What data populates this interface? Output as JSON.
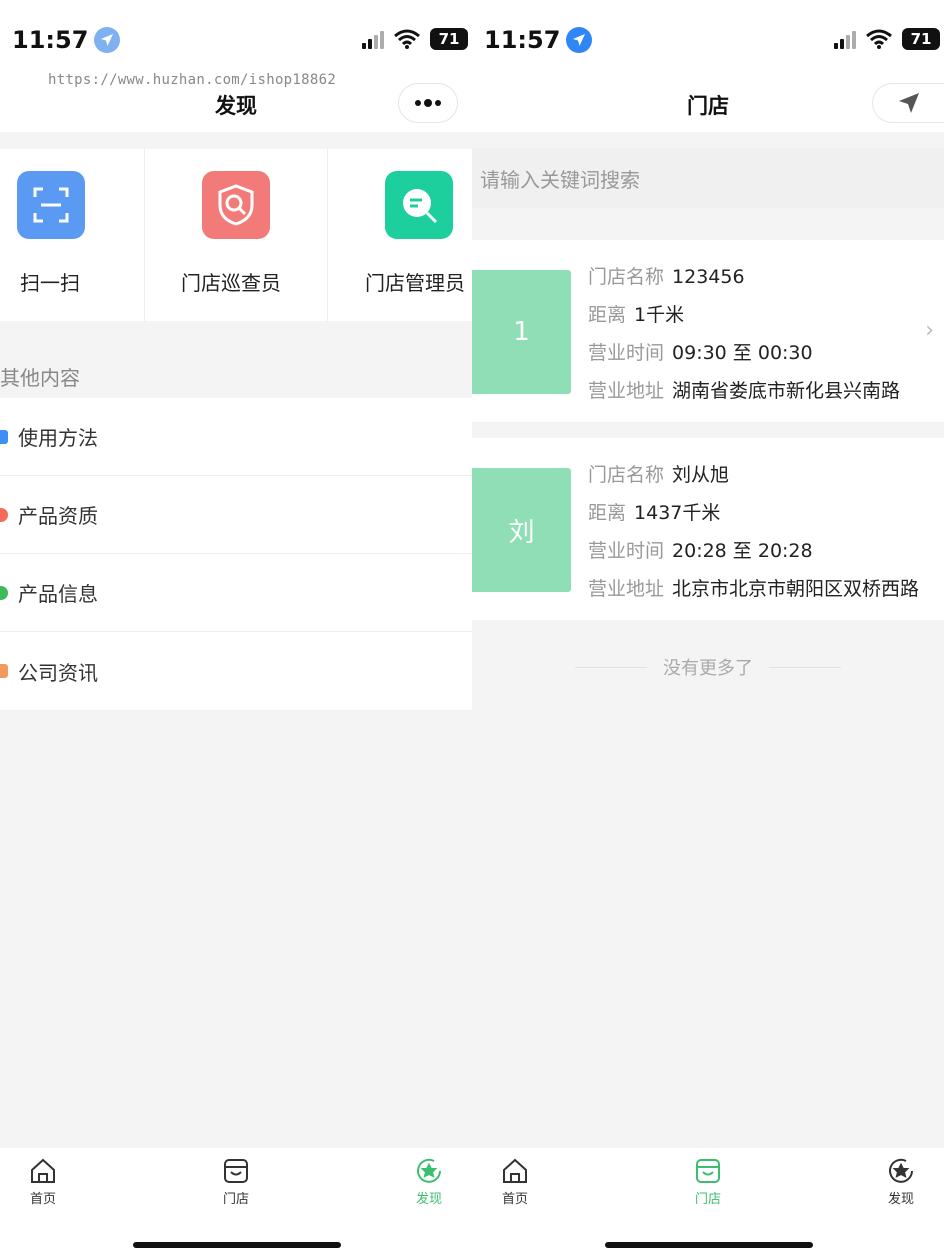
{
  "status_bar": {
    "time": "11:57",
    "battery": "71"
  },
  "watermark": "https://www.huzhan.com/ishop18862",
  "discover": {
    "title": "发现",
    "grid": [
      {
        "label": "扫一扫",
        "icon": "scan-icon",
        "color": "#5b9af3"
      },
      {
        "label": "门店巡查员",
        "icon": "shield-search-icon",
        "color": "#f27a78"
      },
      {
        "label": "门店管理员",
        "icon": "chat-search-icon",
        "color": "#1dcf9c"
      }
    ],
    "section_title": "其他内容",
    "list": [
      {
        "label": "使用方法",
        "icon": "calendar-icon",
        "color": "#3d8ef5"
      },
      {
        "label": "产品资质",
        "icon": "badge-icon",
        "color": "#f26b5b"
      },
      {
        "label": "产品信息",
        "icon": "leaf-icon",
        "color": "#3dbb5b"
      },
      {
        "label": "公司资讯",
        "icon": "news-icon",
        "color": "#f09b5a"
      }
    ]
  },
  "stores": {
    "title": "门店",
    "search_placeholder": "请输入关键词搜索",
    "labels": {
      "name": "门店名称",
      "distance": "距离",
      "hours": "营业时间",
      "address": "营业地址"
    },
    "items": [
      {
        "thumb": "1",
        "name": "123456",
        "distance": "1千米",
        "hours": "09:30 至 00:30",
        "address": "湖南省娄底市新化县兴南路"
      },
      {
        "thumb": "刘",
        "name": "刘从旭",
        "distance": "1437千米",
        "hours": "20:28 至 20:28",
        "address": "北京市北京市朝阳区双桥西路"
      }
    ],
    "no_more": "没有更多了"
  },
  "tabbar": [
    {
      "label": "首页",
      "icon": "home-icon"
    },
    {
      "label": "门店",
      "icon": "store-icon"
    },
    {
      "label": "发现",
      "icon": "discover-icon"
    }
  ],
  "colors": {
    "accent": "#3bbf6e",
    "thumb": "#8fdeb5"
  }
}
